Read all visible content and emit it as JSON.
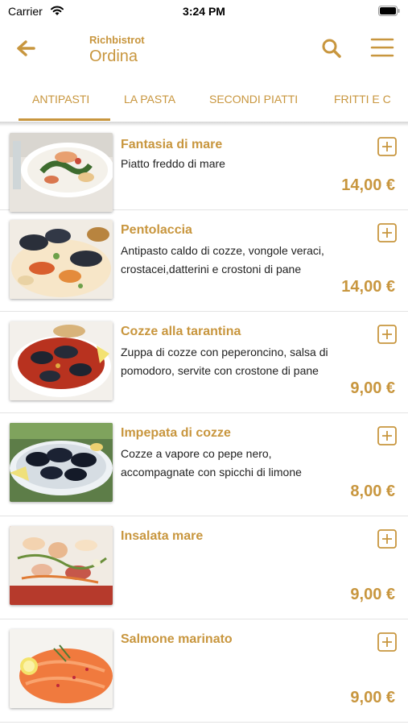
{
  "status_bar": {
    "carrier": "Carrier",
    "time": "3:24 PM"
  },
  "header": {
    "app_name": "Richbistrot",
    "title": "Ordina",
    "accent_color": "#c8963e"
  },
  "tabs": [
    {
      "label": "ANTIPASTI",
      "selected": true
    },
    {
      "label": "LA PASTA",
      "selected": false
    },
    {
      "label": "SECONDI PIATTI",
      "selected": false
    },
    {
      "label": "FRITTI E C",
      "selected": false
    }
  ],
  "items": [
    {
      "name": "Fantasia di mare",
      "description": "Piatto freddo di mare",
      "price": "14,00 €"
    },
    {
      "name": "Pentolaccia",
      "description": "Antipasto caldo di cozze, vongole veraci, crostacei,datterini e crostoni di pane",
      "price": "14,00 €"
    },
    {
      "name": "Cozze alla tarantina",
      "description": "Zuppa di cozze con peperoncino, salsa di pomodoro, servite con crostone di pane",
      "price": "9,00 €"
    },
    {
      "name": "Impepata di cozze",
      "description": "Cozze a vapore co pepe nero, accompagnate con spicchi di limone",
      "price": "8,00 €"
    },
    {
      "name": "Insalata mare",
      "description": "",
      "price": "9,00 €"
    },
    {
      "name": "Salmone marinato",
      "description": "",
      "price": "9,00 €"
    }
  ]
}
